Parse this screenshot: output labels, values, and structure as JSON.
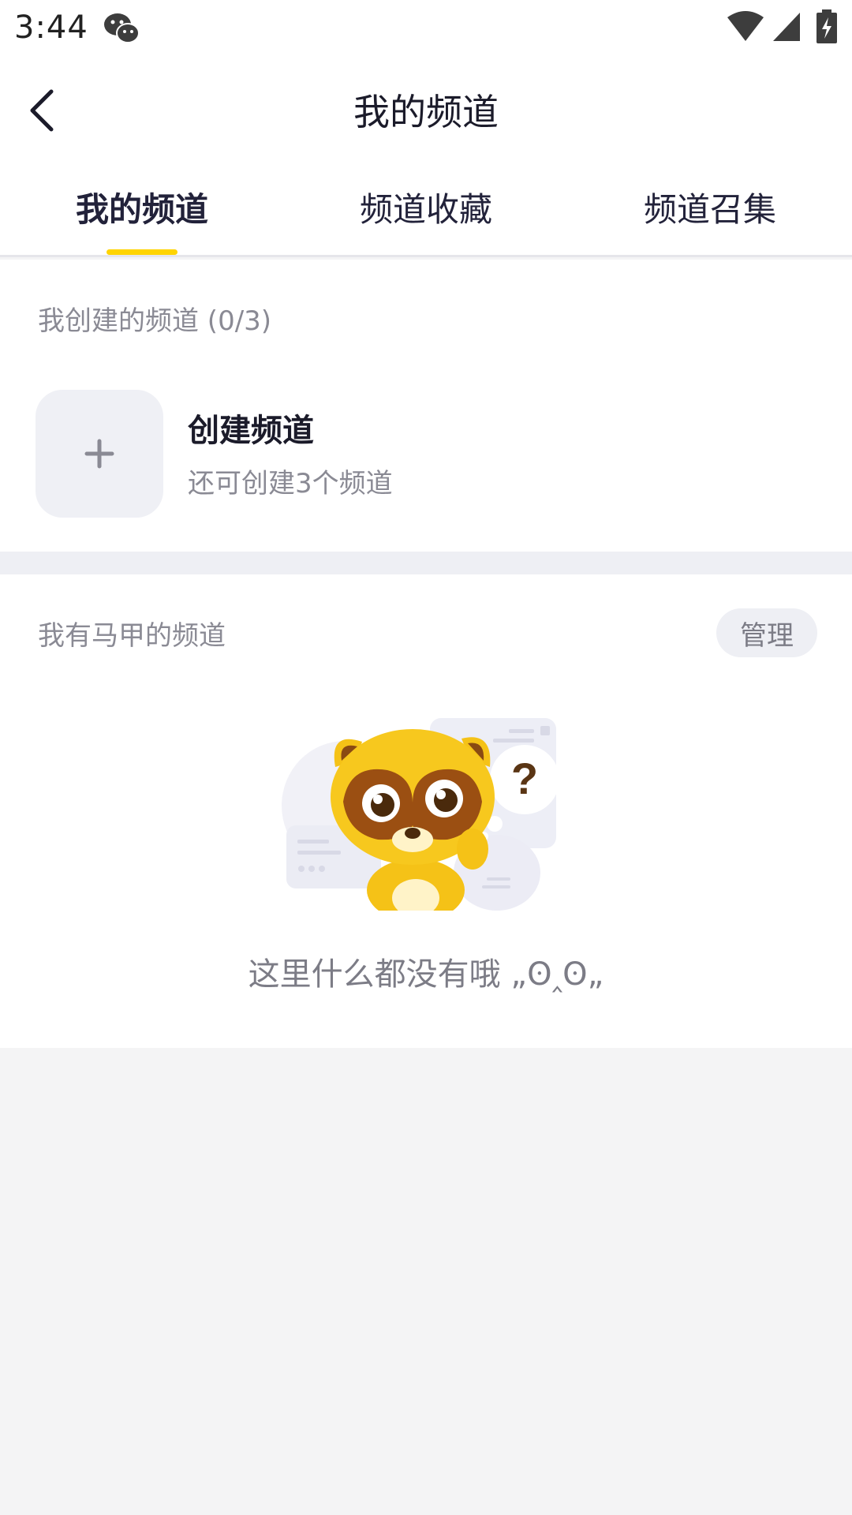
{
  "status_bar": {
    "time": "3:44",
    "icons": [
      "wechat-icon",
      "wifi-icon",
      "signal-icon",
      "battery-charging-icon"
    ]
  },
  "header": {
    "title": "我的频道",
    "back_icon": "chevron-left-icon"
  },
  "tabs": [
    {
      "label": "我的频道",
      "active": true
    },
    {
      "label": "频道收藏",
      "active": false
    },
    {
      "label": "频道召集",
      "active": false
    }
  ],
  "created_section": {
    "label": "我创建的频道 (0/3)",
    "create_title": "创建频道",
    "create_subtitle": "还可创建3个频道",
    "create_icon": "plus-icon"
  },
  "vest_section": {
    "label": "我有马甲的频道",
    "manage_label": "管理",
    "empty_text": "这里什么都没有哦 „ʘ‸ʘ„",
    "illustration": "raccoon-mascot-question-illustration"
  },
  "colors": {
    "accent": "#ffd400",
    "primary_text": "#1b1b2a",
    "secondary_text": "#8a8a94",
    "page_background": "#f4f4f5"
  }
}
